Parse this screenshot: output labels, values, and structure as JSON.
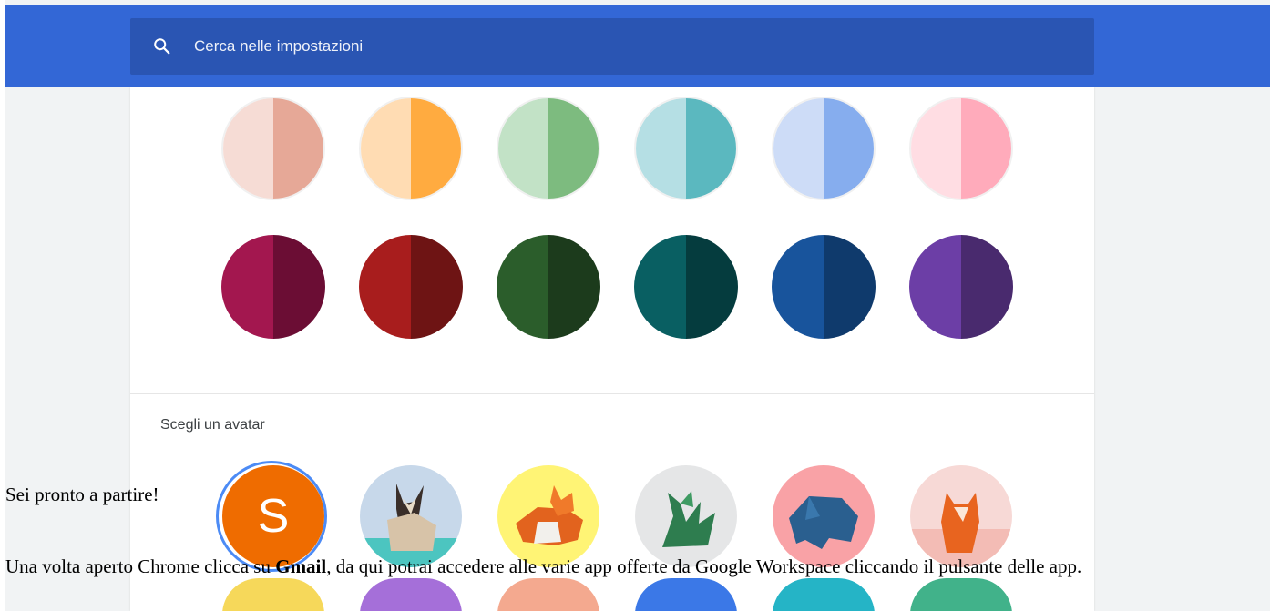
{
  "search": {
    "placeholder": "Cerca nelle impostazioni",
    "icon": "search-icon"
  },
  "colors": {
    "topbar": "#3367d6",
    "searchbox": "#2a55b3",
    "selection_ring": "#4c8bf5",
    "light_themes": [
      {
        "left": "#f6dcd5",
        "right": "#e6a897"
      },
      {
        "left": "#ffdcb3",
        "right": "#ffab40"
      },
      {
        "left": "#c2e2c6",
        "right": "#7dbb7f"
      },
      {
        "left": "#b5dfe4",
        "right": "#5bb8bf"
      },
      {
        "left": "#cddcf7",
        "right": "#86adee"
      },
      {
        "left": "#ffdde3",
        "right": "#ffabbb"
      }
    ],
    "dark_themes": [
      {
        "left": "#a3174f",
        "right": "#6b0d34"
      },
      {
        "left": "#a81d1d",
        "right": "#6e1414"
      },
      {
        "left": "#2b5d2b",
        "right": "#1c3b1c"
      },
      {
        "left": "#095f62",
        "right": "#053c3e"
      },
      {
        "left": "#18549c",
        "right": "#0f3a6c"
      },
      {
        "left": "#6c3ea6",
        "right": "#492a6e"
      }
    ]
  },
  "avatar_section": {
    "heading": "Scegli un avatar",
    "selected_letter": "S",
    "items": [
      {
        "name": "letter-avatar",
        "bg": "#ef6c00"
      },
      {
        "name": "origami-cat-avatar",
        "bg": "#c7d8ea"
      },
      {
        "name": "origami-corgi-avatar",
        "bg": "#fff475"
      },
      {
        "name": "origami-dragon-avatar",
        "bg": "#e5e6e7"
      },
      {
        "name": "origami-elephant-avatar",
        "bg": "#f9a2a6"
      },
      {
        "name": "origami-fox-avatar",
        "bg": "#f7d9d6"
      }
    ],
    "next_row_colors": [
      "#f6d85a",
      "#a56fd9",
      "#f4a98f",
      "#3b78e7",
      "#25b4c6",
      "#41b28a"
    ]
  },
  "overlay_text": {
    "line1": "Sei pronto a partire!",
    "line2_before": "Una volta aperto Chrome clicca su ",
    "line2_bold": "Gmail",
    "line2_after": ", da qui potrai accedere alle varie app offerte da Google Workspace cliccando il pulsante delle app."
  }
}
